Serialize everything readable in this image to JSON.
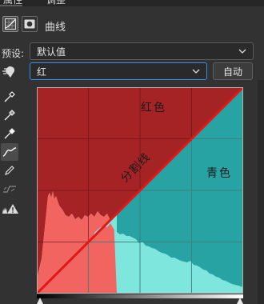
{
  "tabs": [
    {
      "label": "属性"
    },
    {
      "label": "调整"
    }
  ],
  "panel": {
    "title": "曲线",
    "preset_label": "预设:",
    "preset_value": "默认值",
    "channel_value": "红",
    "auto_label": "自动"
  },
  "graph": {
    "upper_label": "红色",
    "lower_label": "青色",
    "diagonal_label": "分割线",
    "colors": {
      "red_region": "#a52325",
      "cyan_region": "#27a3a4",
      "histogram_red": "#f26460",
      "histogram_cyan": "#7ee6dc",
      "curve": "#e01818",
      "grid": "#7a2020"
    }
  },
  "tools": [
    {
      "icon": "eyedropper-black-icon"
    },
    {
      "icon": "eyedropper-gray-icon"
    },
    {
      "icon": "eyedropper-white-icon"
    },
    {
      "icon": "curve-edit-icon"
    },
    {
      "icon": "pencil-icon"
    },
    {
      "icon": "smooth-icon"
    },
    {
      "icon": "clipping-warning-icon"
    }
  ]
}
